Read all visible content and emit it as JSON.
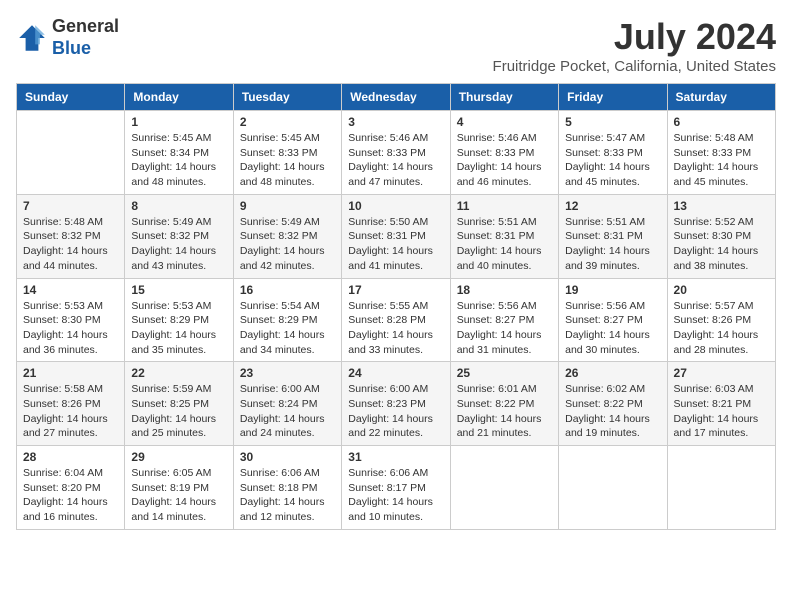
{
  "header": {
    "logo_general": "General",
    "logo_blue": "Blue",
    "main_title": "July 2024",
    "subtitle": "Fruitridge Pocket, California, United States"
  },
  "calendar": {
    "columns": [
      "Sunday",
      "Monday",
      "Tuesday",
      "Wednesday",
      "Thursday",
      "Friday",
      "Saturday"
    ],
    "weeks": [
      [
        {
          "day": "",
          "info": ""
        },
        {
          "day": "1",
          "info": "Sunrise: 5:45 AM\nSunset: 8:34 PM\nDaylight: 14 hours\nand 48 minutes."
        },
        {
          "day": "2",
          "info": "Sunrise: 5:45 AM\nSunset: 8:33 PM\nDaylight: 14 hours\nand 48 minutes."
        },
        {
          "day": "3",
          "info": "Sunrise: 5:46 AM\nSunset: 8:33 PM\nDaylight: 14 hours\nand 47 minutes."
        },
        {
          "day": "4",
          "info": "Sunrise: 5:46 AM\nSunset: 8:33 PM\nDaylight: 14 hours\nand 46 minutes."
        },
        {
          "day": "5",
          "info": "Sunrise: 5:47 AM\nSunset: 8:33 PM\nDaylight: 14 hours\nand 45 minutes."
        },
        {
          "day": "6",
          "info": "Sunrise: 5:48 AM\nSunset: 8:33 PM\nDaylight: 14 hours\nand 45 minutes."
        }
      ],
      [
        {
          "day": "7",
          "info": "Sunrise: 5:48 AM\nSunset: 8:32 PM\nDaylight: 14 hours\nand 44 minutes."
        },
        {
          "day": "8",
          "info": "Sunrise: 5:49 AM\nSunset: 8:32 PM\nDaylight: 14 hours\nand 43 minutes."
        },
        {
          "day": "9",
          "info": "Sunrise: 5:49 AM\nSunset: 8:32 PM\nDaylight: 14 hours\nand 42 minutes."
        },
        {
          "day": "10",
          "info": "Sunrise: 5:50 AM\nSunset: 8:31 PM\nDaylight: 14 hours\nand 41 minutes."
        },
        {
          "day": "11",
          "info": "Sunrise: 5:51 AM\nSunset: 8:31 PM\nDaylight: 14 hours\nand 40 minutes."
        },
        {
          "day": "12",
          "info": "Sunrise: 5:51 AM\nSunset: 8:31 PM\nDaylight: 14 hours\nand 39 minutes."
        },
        {
          "day": "13",
          "info": "Sunrise: 5:52 AM\nSunset: 8:30 PM\nDaylight: 14 hours\nand 38 minutes."
        }
      ],
      [
        {
          "day": "14",
          "info": "Sunrise: 5:53 AM\nSunset: 8:30 PM\nDaylight: 14 hours\nand 36 minutes."
        },
        {
          "day": "15",
          "info": "Sunrise: 5:53 AM\nSunset: 8:29 PM\nDaylight: 14 hours\nand 35 minutes."
        },
        {
          "day": "16",
          "info": "Sunrise: 5:54 AM\nSunset: 8:29 PM\nDaylight: 14 hours\nand 34 minutes."
        },
        {
          "day": "17",
          "info": "Sunrise: 5:55 AM\nSunset: 8:28 PM\nDaylight: 14 hours\nand 33 minutes."
        },
        {
          "day": "18",
          "info": "Sunrise: 5:56 AM\nSunset: 8:27 PM\nDaylight: 14 hours\nand 31 minutes."
        },
        {
          "day": "19",
          "info": "Sunrise: 5:56 AM\nSunset: 8:27 PM\nDaylight: 14 hours\nand 30 minutes."
        },
        {
          "day": "20",
          "info": "Sunrise: 5:57 AM\nSunset: 8:26 PM\nDaylight: 14 hours\nand 28 minutes."
        }
      ],
      [
        {
          "day": "21",
          "info": "Sunrise: 5:58 AM\nSunset: 8:26 PM\nDaylight: 14 hours\nand 27 minutes."
        },
        {
          "day": "22",
          "info": "Sunrise: 5:59 AM\nSunset: 8:25 PM\nDaylight: 14 hours\nand 25 minutes."
        },
        {
          "day": "23",
          "info": "Sunrise: 6:00 AM\nSunset: 8:24 PM\nDaylight: 14 hours\nand 24 minutes."
        },
        {
          "day": "24",
          "info": "Sunrise: 6:00 AM\nSunset: 8:23 PM\nDaylight: 14 hours\nand 22 minutes."
        },
        {
          "day": "25",
          "info": "Sunrise: 6:01 AM\nSunset: 8:22 PM\nDaylight: 14 hours\nand 21 minutes."
        },
        {
          "day": "26",
          "info": "Sunrise: 6:02 AM\nSunset: 8:22 PM\nDaylight: 14 hours\nand 19 minutes."
        },
        {
          "day": "27",
          "info": "Sunrise: 6:03 AM\nSunset: 8:21 PM\nDaylight: 14 hours\nand 17 minutes."
        }
      ],
      [
        {
          "day": "28",
          "info": "Sunrise: 6:04 AM\nSunset: 8:20 PM\nDaylight: 14 hours\nand 16 minutes."
        },
        {
          "day": "29",
          "info": "Sunrise: 6:05 AM\nSunset: 8:19 PM\nDaylight: 14 hours\nand 14 minutes."
        },
        {
          "day": "30",
          "info": "Sunrise: 6:06 AM\nSunset: 8:18 PM\nDaylight: 14 hours\nand 12 minutes."
        },
        {
          "day": "31",
          "info": "Sunrise: 6:06 AM\nSunset: 8:17 PM\nDaylight: 14 hours\nand 10 minutes."
        },
        {
          "day": "",
          "info": ""
        },
        {
          "day": "",
          "info": ""
        },
        {
          "day": "",
          "info": ""
        }
      ]
    ]
  }
}
